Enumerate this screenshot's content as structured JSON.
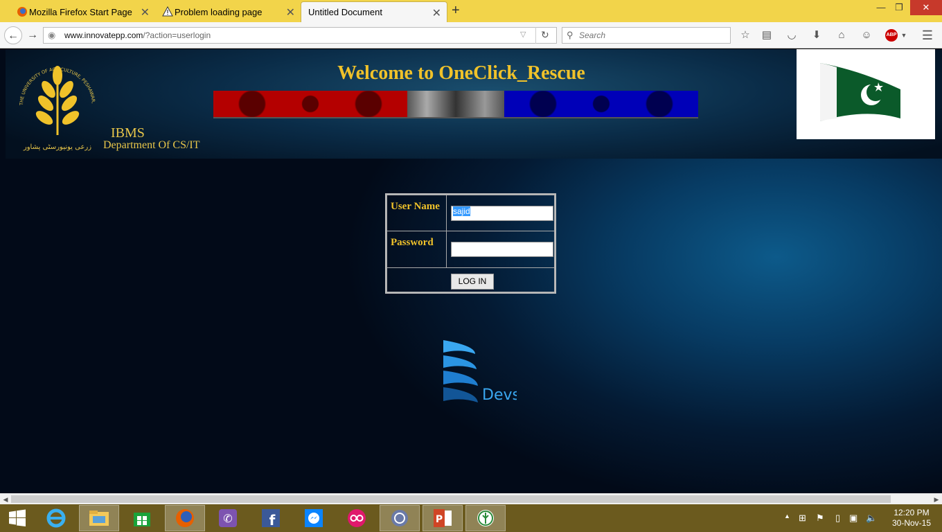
{
  "browser": {
    "tabs": [
      {
        "label": "Mozilla Firefox Start Page",
        "active": false
      },
      {
        "label": "Problem loading page",
        "active": false
      },
      {
        "label": "Untitled Document",
        "active": true
      }
    ],
    "url_domain": "www.innovatepp.com",
    "url_path": "/?action=userlogin",
    "search_placeholder": "Search",
    "adblock_badge": "ABP"
  },
  "page": {
    "welcome_title": "Welcome to OneClick_Rescue",
    "logo_arc_text": "THE UNIVERSITY OF AGRICULTURE, PESHAWAR, PAKISTAN",
    "logo_urdu_text": "زرعی یونیورسٹی پشاور",
    "org_name": "IBMS",
    "department": "Department Of CS/IT",
    "login": {
      "username_label": "User Name",
      "username_value": "sajid",
      "password_label": "Password",
      "password_value": "",
      "submit_label": "LOG IN"
    },
    "devs_logo_text": "Devs"
  },
  "taskbar": {
    "time": "12:20 PM",
    "date": "30-Nov-15"
  },
  "colors": {
    "tabbar": "#f2d44a",
    "accent_gold": "#f0c22a",
    "taskbar": "#6b5a1e",
    "close_red": "#c7392b"
  }
}
